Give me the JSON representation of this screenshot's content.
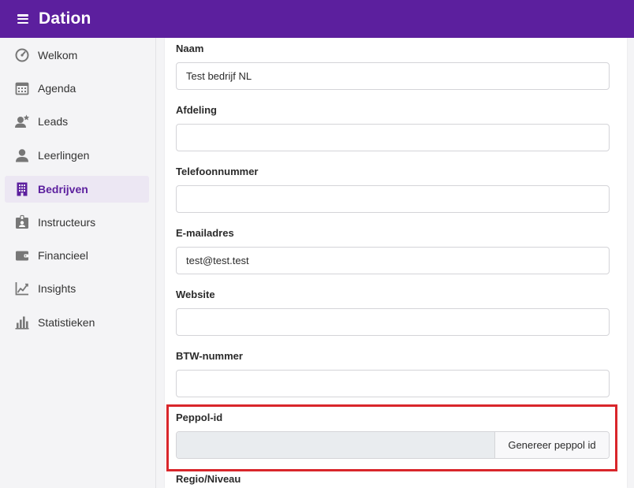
{
  "app": {
    "brand": "Dation"
  },
  "sidebar": {
    "items": [
      {
        "label": "Welkom",
        "icon": "speedometer-icon",
        "active": false
      },
      {
        "label": "Agenda",
        "icon": "calendar-icon",
        "active": false
      },
      {
        "label": "Leads",
        "icon": "user-star-icon",
        "active": false
      },
      {
        "label": "Leerlingen",
        "icon": "user-icon",
        "active": false
      },
      {
        "label": "Bedrijven",
        "icon": "building-icon",
        "active": true
      },
      {
        "label": "Instructeurs",
        "icon": "id-badge-icon",
        "active": false
      },
      {
        "label": "Financieel",
        "icon": "wallet-icon",
        "active": false
      },
      {
        "label": "Insights",
        "icon": "line-chart-icon",
        "active": false
      },
      {
        "label": "Statistieken",
        "icon": "bar-chart-icon",
        "active": false
      }
    ]
  },
  "form": {
    "naam": {
      "label": "Naam",
      "value": "Test bedrijf NL"
    },
    "afdeling": {
      "label": "Afdeling",
      "value": ""
    },
    "telefoon": {
      "label": "Telefoonnummer",
      "value": ""
    },
    "email": {
      "label": "E-mailadres",
      "value": "test@test.test"
    },
    "website": {
      "label": "Website",
      "value": ""
    },
    "btw": {
      "label": "BTW-nummer",
      "value": ""
    },
    "peppol": {
      "label": "Peppol-id",
      "value": "",
      "button": "Genereer peppol id"
    },
    "regio": {
      "label": "Regio/Niveau"
    }
  },
  "colors": {
    "brand": "#5c1f9e",
    "highlight": "#d9262b",
    "active_bg": "#ece7f3"
  }
}
